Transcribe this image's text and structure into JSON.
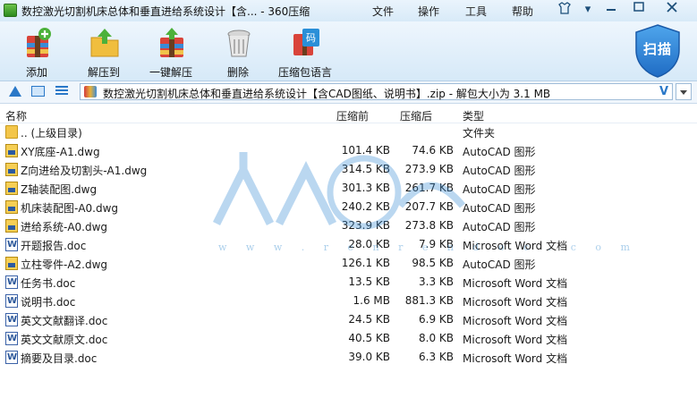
{
  "window": {
    "title": "数控激光切割机床总体和垂直进给系统设计【含... - 360压缩",
    "menus": [
      "文件",
      "操作",
      "工具",
      "帮助"
    ]
  },
  "toolbar": {
    "buttons": [
      {
        "label": "添加",
        "icon": "add-archive-icon"
      },
      {
        "label": "解压到",
        "icon": "extract-to-folder-icon"
      },
      {
        "label": "一键解压",
        "icon": "one-click-extract-icon"
      },
      {
        "label": "删除",
        "icon": "trash-bin-icon"
      },
      {
        "label": "压缩包语言",
        "icon": "archive-language-icon"
      }
    ],
    "scan_label": "扫描"
  },
  "addressbar": {
    "path": "数控激光切割机床总体和垂直进给系统设计【含CAD图纸、说明书】.zip - 解包大小为 3.1 MB",
    "v_label": "V"
  },
  "columns": {
    "name": "名称",
    "compressed": "压缩前",
    "original": "压缩后",
    "type": "类型"
  },
  "files": [
    {
      "name": ".. (上级目录)",
      "compressed": "",
      "original": "",
      "type": "文件夹",
      "icon": "folder"
    },
    {
      "name": "XY底座-A1.dwg",
      "compressed": "101.4 KB",
      "original": "74.6 KB",
      "type": "AutoCAD 图形",
      "icon": "dwg"
    },
    {
      "name": "Z向进给及切割头-A1.dwg",
      "compressed": "314.5 KB",
      "original": "273.9 KB",
      "type": "AutoCAD 图形",
      "icon": "dwg"
    },
    {
      "name": "Z轴装配图.dwg",
      "compressed": "301.3 KB",
      "original": "261.7 KB",
      "type": "AutoCAD 图形",
      "icon": "dwg"
    },
    {
      "name": "机床装配图-A0.dwg",
      "compressed": "240.2 KB",
      "original": "207.7 KB",
      "type": "AutoCAD 图形",
      "icon": "dwg"
    },
    {
      "name": "进给系统-A0.dwg",
      "compressed": "323.9 KB",
      "original": "273.8 KB",
      "type": "AutoCAD 图形",
      "icon": "dwg"
    },
    {
      "name": "开题报告.doc",
      "compressed": "28.0 KB",
      "original": "7.9 KB",
      "type": "Microsoft Word 文档",
      "icon": "doc"
    },
    {
      "name": "立柱零件-A2.dwg",
      "compressed": "126.1 KB",
      "original": "98.5 KB",
      "type": "AutoCAD 图形",
      "icon": "dwg"
    },
    {
      "name": "任务书.doc",
      "compressed": "13.5 KB",
      "original": "3.3 KB",
      "type": "Microsoft Word 文档",
      "icon": "doc"
    },
    {
      "name": "说明书.doc",
      "compressed": "1.6 MB",
      "original": "881.3 KB",
      "type": "Microsoft Word 文档",
      "icon": "doc"
    },
    {
      "name": "英文文献翻译.doc",
      "compressed": "24.5 KB",
      "original": "6.9 KB",
      "type": "Microsoft Word 文档",
      "icon": "doc"
    },
    {
      "name": "英文文献原文.doc",
      "compressed": "40.5 KB",
      "original": "8.0 KB",
      "type": "Microsoft Word 文档",
      "icon": "doc"
    },
    {
      "name": "摘要及目录.doc",
      "compressed": "39.0 KB",
      "original": "6.3 KB",
      "type": "Microsoft Word 文档",
      "icon": "doc"
    }
  ],
  "watermark": {
    "text": "w w w . r e n r e n d o c . c o m"
  }
}
